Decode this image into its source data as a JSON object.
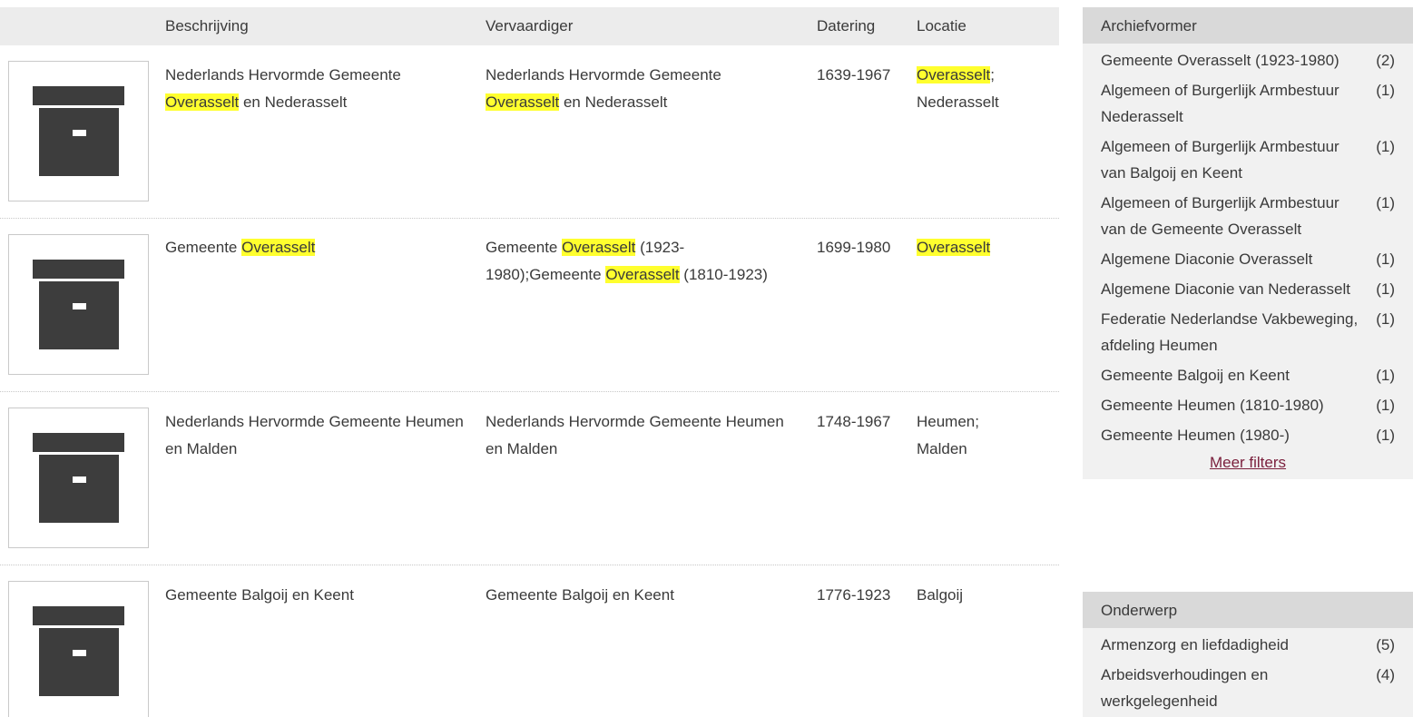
{
  "table": {
    "headers": {
      "beschrijving": "Beschrijving",
      "vervaardiger": "Vervaardiger",
      "datering": "Datering",
      "locatie": "Locatie"
    },
    "rows": [
      {
        "beschrijving": [
          [
            "Nederlands Hervormde Gemeente ",
            false
          ],
          [
            "Overasselt",
            true
          ],
          [
            " en Nederasselt",
            false
          ]
        ],
        "vervaardiger": [
          [
            "Nederlands Hervormde Gemeente ",
            false
          ],
          [
            "Overasselt",
            true
          ],
          [
            " en Nederasselt",
            false
          ]
        ],
        "datering": "1639-1967",
        "locatie": [
          [
            "Overasselt",
            true
          ],
          [
            "; Nederasselt",
            false
          ]
        ]
      },
      {
        "beschrijving": [
          [
            "Gemeente ",
            false
          ],
          [
            "Overasselt",
            true
          ]
        ],
        "vervaardiger": [
          [
            "Gemeente ",
            false
          ],
          [
            "Overasselt",
            true
          ],
          [
            " (1923-1980);Gemeente ",
            false
          ],
          [
            "Overasselt",
            true
          ],
          [
            " (1810-1923)",
            false
          ]
        ],
        "datering": "1699-1980",
        "locatie": [
          [
            "Overasselt",
            true
          ]
        ]
      },
      {
        "beschrijving": [
          [
            "Nederlands Hervormde Gemeente Heumen en Malden",
            false
          ]
        ],
        "vervaardiger": [
          [
            "Nederlands Hervormde Gemeente Heumen en Malden",
            false
          ]
        ],
        "datering": "1748-1967",
        "locatie": [
          [
            "Heumen; Malden",
            false
          ]
        ]
      },
      {
        "beschrijving": [
          [
            "Gemeente Balgoij en Keent",
            false
          ]
        ],
        "vervaardiger": [
          [
            "Gemeente Balgoij en Keent",
            false
          ]
        ],
        "datering": "1776-1923",
        "locatie": [
          [
            "Balgoij",
            false
          ]
        ]
      }
    ]
  },
  "facets": {
    "archiefvormer": {
      "title": "Archiefvormer",
      "items": [
        {
          "label": "Gemeente Overasselt (1923-1980)",
          "count": "(2)"
        },
        {
          "label": "Algemeen of Burgerlijk Armbestuur Nederasselt",
          "count": "(1)"
        },
        {
          "label": "Algemeen of Burgerlijk Armbestuur van Balgoij en Keent",
          "count": "(1)"
        },
        {
          "label": "Algemeen of Burgerlijk Armbestuur van de Gemeente Overasselt",
          "count": "(1)"
        },
        {
          "label": "Algemene Diaconie Overasselt",
          "count": "(1)"
        },
        {
          "label": "Algemene Diaconie van Nederasselt",
          "count": "(1)"
        },
        {
          "label": "Federatie Nederlandse Vakbeweging, afdeling Heumen",
          "count": "(1)"
        },
        {
          "label": "Gemeente Balgoij en Keent",
          "count": "(1)"
        },
        {
          "label": "Gemeente Heumen (1810-1980)",
          "count": "(1)"
        },
        {
          "label": "Gemeente Heumen (1980-)",
          "count": "(1)"
        }
      ],
      "more_label": "Meer filters"
    },
    "onderwerp": {
      "title": "Onderwerp",
      "items": [
        {
          "label": "Armenzorg en liefdadigheid",
          "count": "(5)"
        },
        {
          "label": "Arbeidsverhoudingen en werkgelegenheid",
          "count": "(4)"
        }
      ]
    }
  },
  "icons": {
    "thumbnail": "archive-box-icon"
  },
  "colors": {
    "highlight": "#ffff2e",
    "link": "#7a1f3c",
    "icon": "#3d3d3d"
  }
}
